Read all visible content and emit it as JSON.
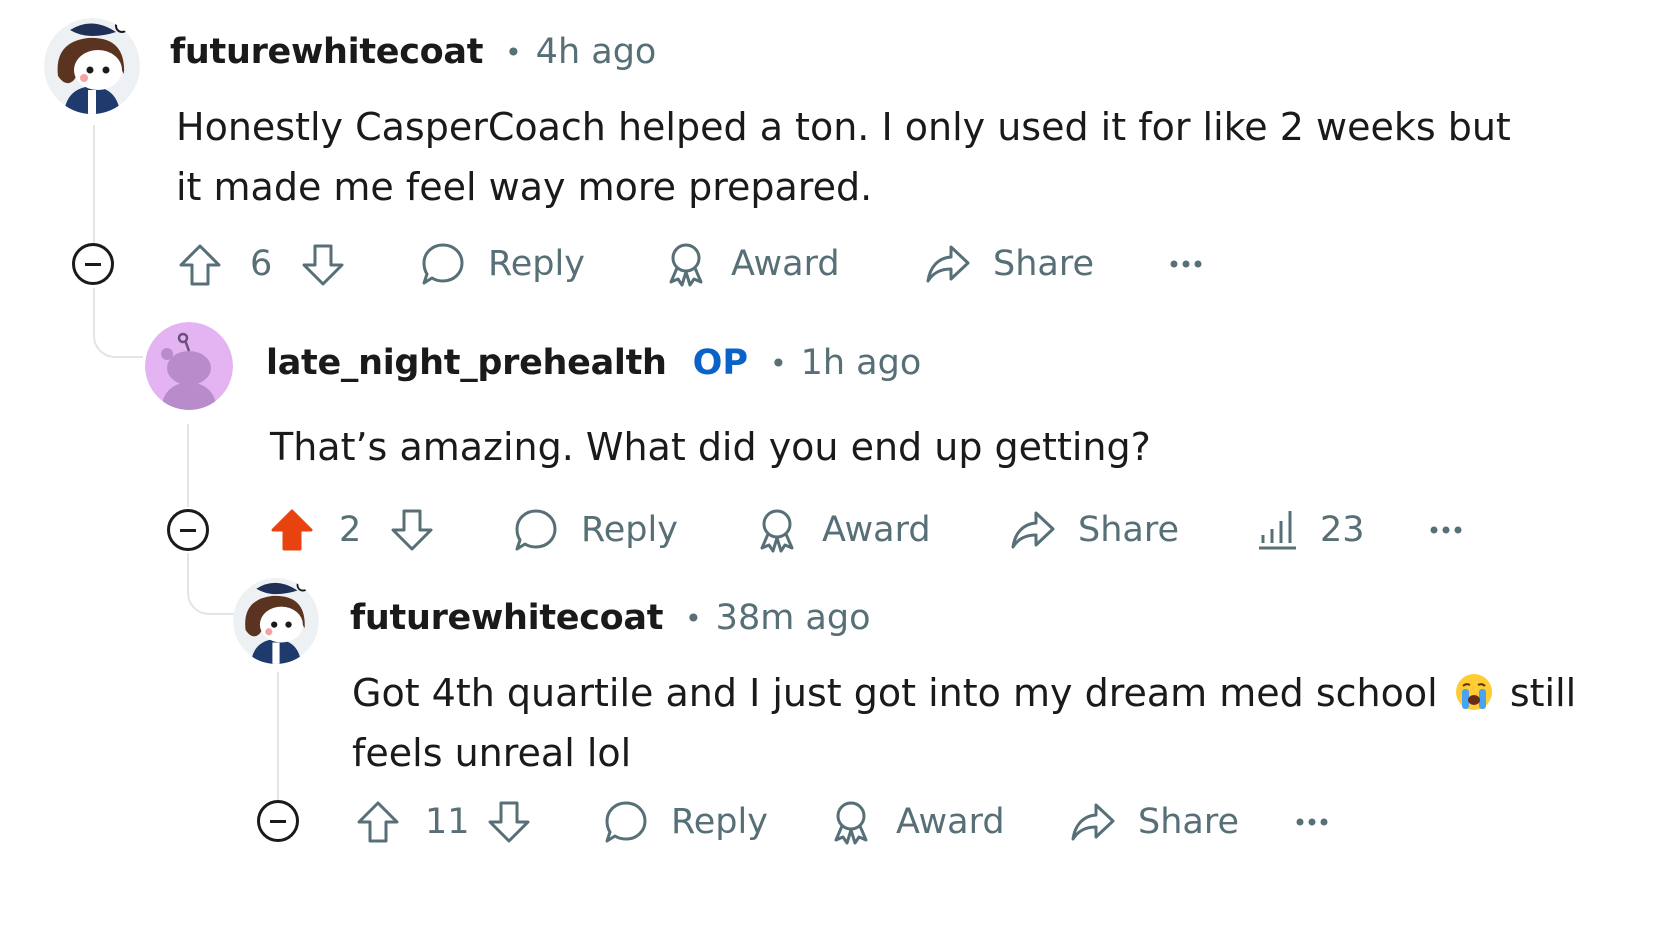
{
  "comments": [
    {
      "username": "futurewhitecoat",
      "time": "4h ago",
      "body_line1": "Honestly CasperCoach helped a ton. I only used it for like 2 weeks but",
      "body_line2": "it made me feel way more prepared.",
      "score": "6",
      "upvoted": false,
      "actions": {
        "reply": "Reply",
        "award": "Award",
        "share": "Share"
      }
    },
    {
      "username": "late_night_prehealth",
      "badge": "OP",
      "time": "1h ago",
      "body_line1": "That’s amazing. What did you end up getting?",
      "score": "2",
      "upvoted": true,
      "views": "23",
      "actions": {
        "reply": "Reply",
        "award": "Award",
        "share": "Share"
      }
    },
    {
      "username": "futurewhitecoat",
      "time": "38m ago",
      "body_line1_before_emoji": "Got 4th quartile and I just got into my dream med school",
      "emoji": "loudly-crying-face",
      "body_line1_after_emoji": "still",
      "body_line2": "feels unreal lol",
      "score": "11",
      "upvoted": false,
      "actions": {
        "reply": "Reply",
        "award": "Award",
        "share": "Share"
      }
    }
  ],
  "colors": {
    "upvote_active": "#e8420f",
    "op_badge": "#0a63c9",
    "muted_text": "#576f76",
    "thread_line": "#e2e5e8",
    "avatar_purple": "#e4b3f1"
  }
}
